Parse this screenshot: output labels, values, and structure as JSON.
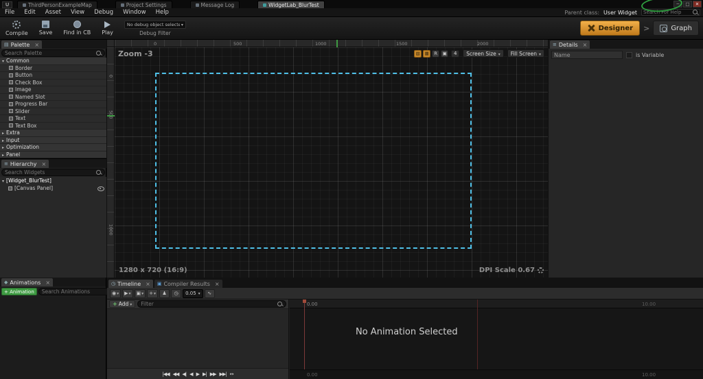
{
  "colors": {
    "accent_orange": "#d98c2e",
    "selection_blue": "#4fc1e9",
    "animation_green": "#3f9b43",
    "playhead_red": "#7e3a3a"
  },
  "titlebar": {
    "tabs": [
      "ThirdPersonExampleMap",
      "Project Settings",
      "Message Log",
      "WidgetLab_BlurTest"
    ],
    "minimize": "─",
    "maximize": "□",
    "close": "✕"
  },
  "menubar": {
    "items": [
      "File",
      "Edit",
      "Asset",
      "View",
      "Debug",
      "Window",
      "Help"
    ],
    "parent_class_label": "Parent class:",
    "parent_class_value": "User Widget",
    "help_search_placeholder": "Search For Help"
  },
  "toolbar": {
    "compile": "Compile",
    "save": "Save",
    "find_in_cb": "Find in CB",
    "play": "Play",
    "debug_dropdown": "No debug object selected",
    "debug_filter_label": "Debug Filter",
    "designer": "Designer",
    "graph": "Graph"
  },
  "palette": {
    "title": "Palette",
    "search_placeholder": "Search Palette",
    "categories": [
      {
        "label": "Common",
        "items": [
          "Border",
          "Button",
          "Check Box",
          "Image",
          "Named Slot",
          "Progress Bar",
          "Slider",
          "Text",
          "Text Box"
        ]
      },
      {
        "label": "Extra",
        "items": []
      },
      {
        "label": "Input",
        "items": []
      },
      {
        "label": "Optimization",
        "items": []
      },
      {
        "label": "Panel",
        "items": []
      }
    ]
  },
  "hierarchy": {
    "title": "Hierarchy",
    "search_placeholder": "Search Widgets",
    "root_label": "[Widget_BlurTest]",
    "child_label": "[Canvas Panel]"
  },
  "animations": {
    "title": "Animations",
    "add_button": "+ Animation",
    "search_placeholder": "Search Animations"
  },
  "viewport": {
    "zoom_label": "Zoom -3",
    "ruler_top": [
      "0",
      "500",
      "1000",
      "1500",
      "2000"
    ],
    "ruler_left": [
      "0",
      "500",
      "1000"
    ],
    "toolbar_buttons": [
      "▧",
      "▦",
      "R",
      "▣"
    ],
    "snap_value": "4",
    "screen_size_label": "Screen Size",
    "fill_screen_label": "Fill Screen",
    "resolution_label": "1280 x 720 (16:9)",
    "dpi_label": "DPI Scale 0.67"
  },
  "details": {
    "title": "Details",
    "name_label": "Name",
    "is_variable_label": "is Variable"
  },
  "timeline": {
    "tab_timeline": "Timeline",
    "tab_compiler": "Compiler Results",
    "toolbar_icons": [
      "◉",
      "▶",
      "▣",
      "+",
      "♟",
      "◷",
      "∿"
    ],
    "rate_value": "0.05",
    "add_button": "Add",
    "filter_placeholder": "Filter",
    "no_animation_text": "No Animation Selected",
    "time_markers": [
      "0.00",
      "10.00"
    ],
    "transport": [
      "|◀◀",
      "◀◀",
      "◀|",
      "◀",
      "▶",
      "▶|",
      "▶▶",
      "▶▶|",
      "↔"
    ]
  }
}
